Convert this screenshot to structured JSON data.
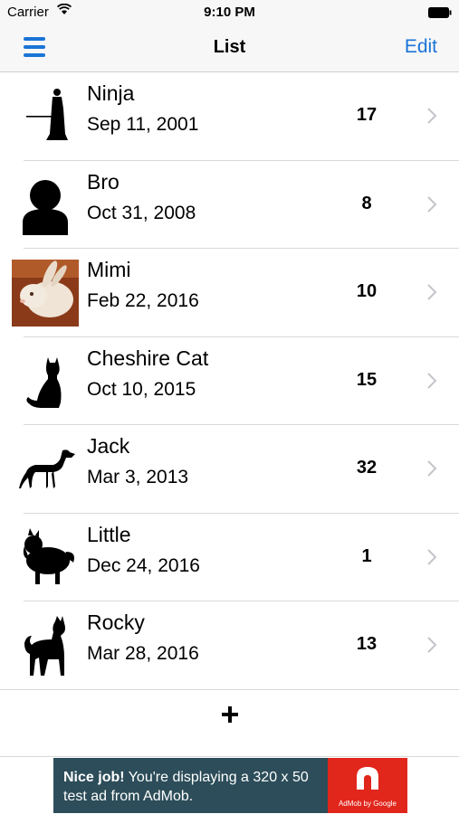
{
  "status_bar": {
    "carrier": "Carrier",
    "time": "9:10 PM"
  },
  "nav": {
    "title": "List",
    "edit_label": "Edit"
  },
  "rows": [
    {
      "name": "Ninja",
      "date": "Sep 11, 2001",
      "count": "17",
      "icon": "ninja-silhouette-icon"
    },
    {
      "name": "Bro",
      "date": "Oct 31, 2008",
      "count": "8",
      "icon": "person-silhouette-icon"
    },
    {
      "name": "Mimi",
      "date": "Feb 22, 2016",
      "count": "10",
      "icon": "rabbit-photo"
    },
    {
      "name": "Cheshire Cat",
      "date": "Oct 10, 2015",
      "count": "15",
      "icon": "cat-silhouette-icon"
    },
    {
      "name": "Jack",
      "date": "Mar 3, 2013",
      "count": "32",
      "icon": "dog-silhouette-icon"
    },
    {
      "name": "Little",
      "date": "Dec 24, 2016",
      "count": "1",
      "icon": "fluffy-dog-silhouette-icon"
    },
    {
      "name": "Rocky",
      "date": "Mar 28, 2016",
      "count": "13",
      "icon": "shiba-silhouette-icon"
    }
  ],
  "add_label": "+",
  "ad": {
    "headline": "Nice job!",
    "body_1": " You're displaying a 320 x 50",
    "body_2": "test ad from AdMob.",
    "logo_text": "AdMob by Google"
  },
  "colors": {
    "accent": "#1a74d6",
    "ad_background": "#2c4d59",
    "ad_logo": "#e1261c"
  }
}
